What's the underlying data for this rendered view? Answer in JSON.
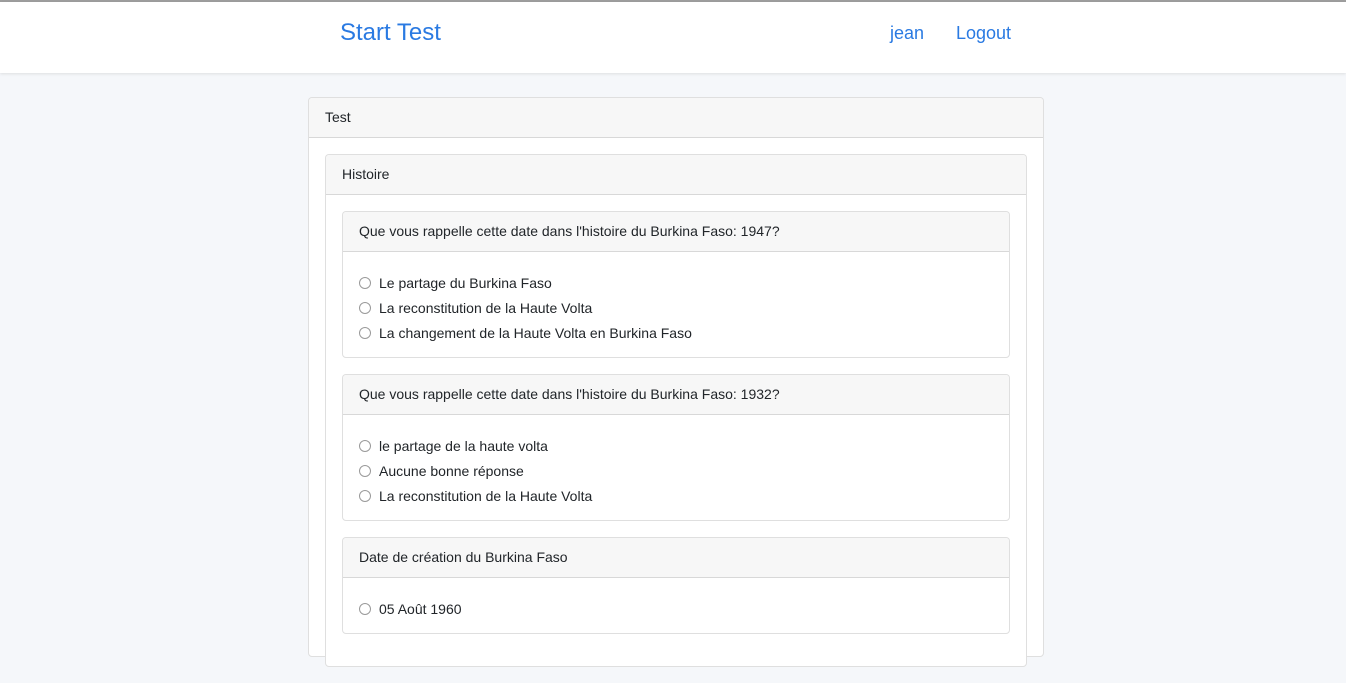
{
  "navbar": {
    "brand": "Start Test",
    "user": "jean",
    "logout": "Logout"
  },
  "test": {
    "title": "Test",
    "section": {
      "title": "Histoire",
      "questions": [
        {
          "text": "Que vous rappelle cette date dans l'histoire du Burkina Faso: 1947?",
          "options": [
            "Le partage du Burkina Faso",
            "La reconstitution de la Haute Volta",
            "La changement de la Haute Volta en Burkina Faso"
          ]
        },
        {
          "text": "Que vous rappelle cette date dans l'histoire du Burkina Faso: 1932?",
          "options": [
            "le partage de la haute volta",
            "Aucune bonne réponse",
            "La reconstitution de la Haute Volta"
          ]
        },
        {
          "text": "Date de création du Burkina Faso",
          "options": [
            "05 Août 1960"
          ]
        }
      ]
    }
  }
}
